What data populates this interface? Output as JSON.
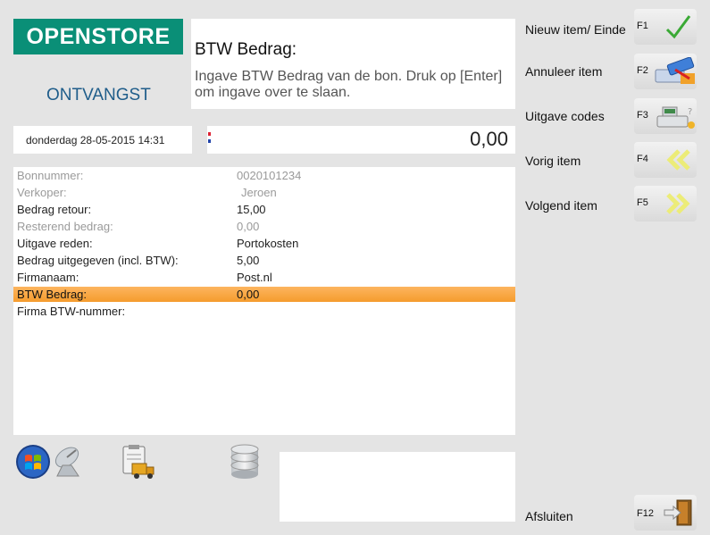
{
  "brand": {
    "logo": "OPENSTORE",
    "screen_title": "ONTVANGST"
  },
  "prompt": {
    "heading": "BTW Bedrag:",
    "text": "Ingave BTW Bedrag van de bon. Druk op [Enter] om ingave over te slaan."
  },
  "datetime": "donderdag 28-05-2015 14:31",
  "amount_value": "0,00",
  "fields": [
    {
      "label": "Bonnummer:",
      "value": "0020101234",
      "state": "dim"
    },
    {
      "label": "Verkoper:",
      "value": "Jeroen",
      "state": "dim"
    },
    {
      "label": "Bedrag retour:",
      "value": "15,00",
      "state": "normal"
    },
    {
      "label": "Resterend bedrag:",
      "value": "0,00",
      "state": "dim"
    },
    {
      "label": "Uitgave reden:",
      "value": "Portokosten",
      "state": "normal"
    },
    {
      "label": "Bedrag uitgegeven (incl. BTW):",
      "value": "5,00",
      "state": "normal"
    },
    {
      "label": "Firmanaam:",
      "value": "Post.nl",
      "state": "normal"
    },
    {
      "label": "BTW Bedrag:",
      "value": "0,00",
      "state": "selected"
    },
    {
      "label": "Firma BTW-nummer:",
      "value": "",
      "state": "normal"
    }
  ],
  "function_keys": [
    {
      "label": "Nieuw item/ Einde",
      "key": "F1",
      "icon": "checkmark-icon"
    },
    {
      "label": "Annuleer item",
      "key": "F2",
      "icon": "cancel-card-icon"
    },
    {
      "label": "Uitgave codes",
      "key": "F3",
      "icon": "cash-register-icon"
    },
    {
      "label": "Vorig item",
      "key": "F4",
      "icon": "double-chevron-left-icon"
    },
    {
      "label": "Volgend item",
      "key": "F5",
      "icon": "double-chevron-right-icon"
    },
    {
      "label": "Afsluiten",
      "key": "F12",
      "icon": "exit-door-icon"
    }
  ],
  "bottom_icons": [
    "windows-start-icon",
    "satellite-dish-icon",
    "clipboard-delivery-icon",
    "database-icon"
  ],
  "colors": {
    "brand": "#0a8f77",
    "title": "#1f5d8a",
    "selection": "#f7a23a",
    "check": "#3aa935",
    "chevron": "#e8e86a"
  }
}
